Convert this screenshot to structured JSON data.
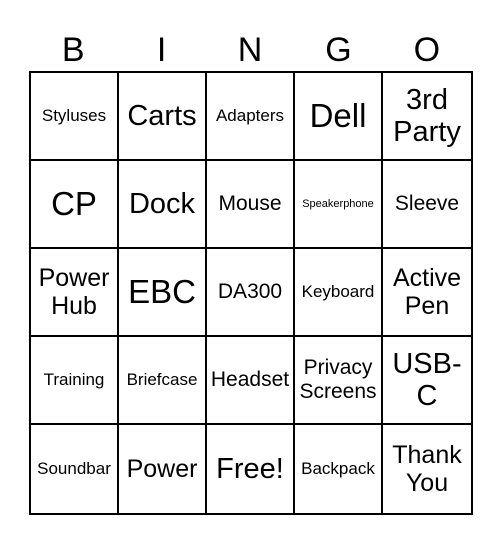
{
  "header": {
    "letters": [
      "B",
      "I",
      "N",
      "G",
      "O"
    ]
  },
  "card": {
    "rows": [
      [
        {
          "text": "Styluses",
          "size": "s"
        },
        {
          "text": "Carts",
          "size": "xl"
        },
        {
          "text": "Adapters",
          "size": "s"
        },
        {
          "text": "Dell",
          "size": "xxl"
        },
        {
          "text": "3rd Party",
          "size": "xl"
        }
      ],
      [
        {
          "text": "CP",
          "size": "xxl"
        },
        {
          "text": "Dock",
          "size": "xl"
        },
        {
          "text": "Mouse",
          "size": "m"
        },
        {
          "text": "Speakerphone",
          "size": "xs"
        },
        {
          "text": "Sleeve",
          "size": "m"
        }
      ],
      [
        {
          "text": "Power Hub",
          "size": "l"
        },
        {
          "text": "EBC",
          "size": "xxl"
        },
        {
          "text": "DA300",
          "size": "m"
        },
        {
          "text": "Keyboard",
          "size": "s"
        },
        {
          "text": "Active Pen",
          "size": "l"
        }
      ],
      [
        {
          "text": "Training",
          "size": "s"
        },
        {
          "text": "Briefcase",
          "size": "s"
        },
        {
          "text": "Headset",
          "size": "m"
        },
        {
          "text": "Privacy Screens",
          "size": "m"
        },
        {
          "text": "USB-C",
          "size": "xl"
        }
      ],
      [
        {
          "text": "Soundbar",
          "size": "s"
        },
        {
          "text": "Power",
          "size": "l"
        },
        {
          "text": "Free!",
          "size": "xl"
        },
        {
          "text": "Backpack",
          "size": "s"
        },
        {
          "text": "Thank You",
          "size": "l"
        }
      ]
    ]
  }
}
